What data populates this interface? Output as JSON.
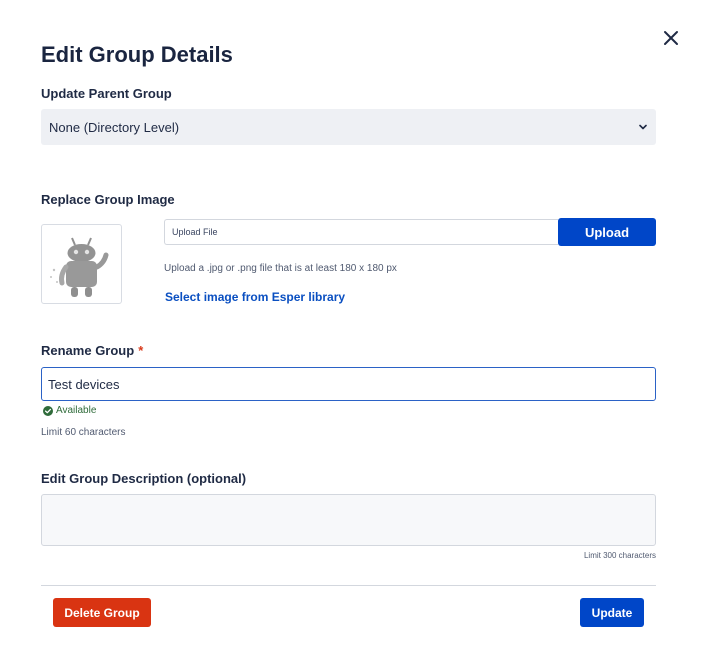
{
  "dialog": {
    "title": "Edit Group Details"
  },
  "parent_group": {
    "label": "Update Parent Group",
    "selected": "None (Directory Level)"
  },
  "group_image": {
    "label": "Replace Group Image",
    "upload_field_text": "Upload File",
    "upload_button": "Upload",
    "hint": "Upload a .jpg or .png file that is at least 180 x 180 px",
    "library_link": "Select image from Esper library"
  },
  "rename": {
    "label": "Rename Group",
    "required_mark": "*",
    "value": "Test devices",
    "status": "Available",
    "limit": "Limit 60 characters"
  },
  "description": {
    "label": "Edit Group Description (optional)",
    "value": "",
    "limit": "Limit 300 characters"
  },
  "footer": {
    "delete_button": "Delete Group",
    "update_button": "Update"
  },
  "colors": {
    "primary": "#0046c8",
    "danger": "#d93412",
    "success": "#2f6b3a"
  }
}
